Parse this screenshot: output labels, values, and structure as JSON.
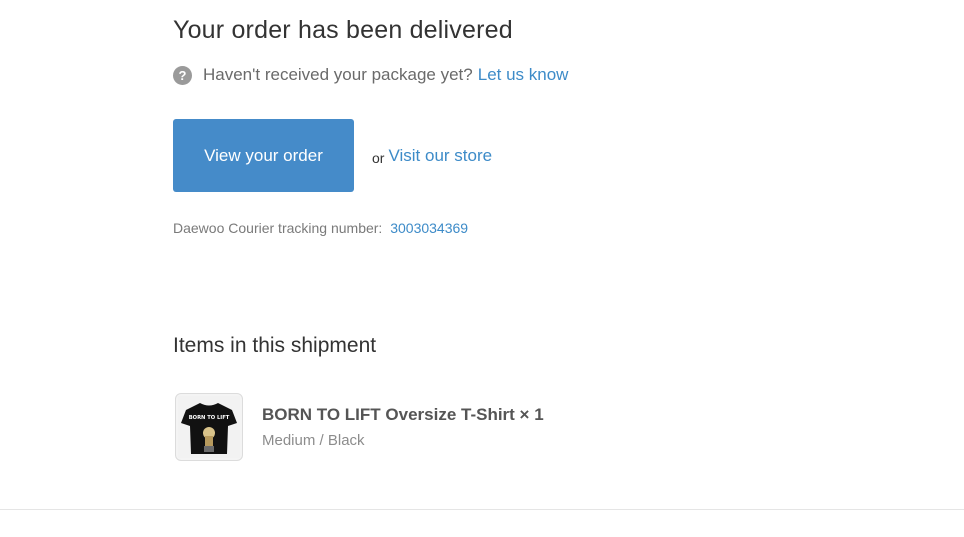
{
  "heading": "Your order has been delivered",
  "help": {
    "icon": "question-circle-icon",
    "text": "Haven't received your package yet?",
    "link": "Let us know"
  },
  "actions": {
    "view_order_label": "View your order",
    "or_text": "or",
    "visit_store_label": "Visit our store"
  },
  "tracking": {
    "label": "Daewoo Courier tracking number:",
    "number": "3003034369"
  },
  "shipment": {
    "title": "Items in this shipment",
    "items": [
      {
        "name": "BORN TO LIFT Oversize T-Shirt × 1",
        "variant": "Medium / Black",
        "thumb_text": "BORN TO LIFT"
      }
    ]
  },
  "colors": {
    "accent": "#458bc9",
    "link": "#3d8bc8"
  }
}
